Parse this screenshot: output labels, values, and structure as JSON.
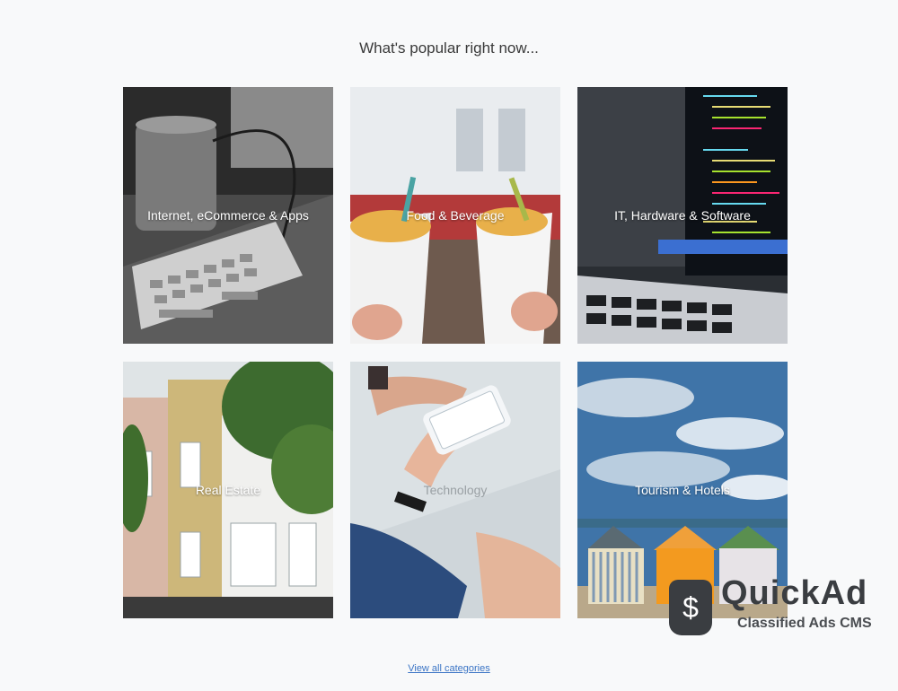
{
  "section": {
    "heading": "What's popular right now..."
  },
  "categories": [
    {
      "label": "Internet, eCommerce & Apps",
      "icon": "keyboard-coffee-photo"
    },
    {
      "label": "Food & Beverage",
      "icon": "fries-photo"
    },
    {
      "label": "IT, Hardware & Software",
      "icon": "laptop-code-photo"
    },
    {
      "label": "Real Estate",
      "icon": "houses-photo"
    },
    {
      "label": "Technology",
      "icon": "phone-hands-photo"
    },
    {
      "label": "Tourism & Hotels",
      "icon": "beach-huts-photo"
    }
  ],
  "view_all": {
    "label": "View all categories"
  },
  "watermark": {
    "brand": "QuickAd",
    "tagline": "Classified Ads CMS",
    "symbol": "$"
  },
  "colors": {
    "link": "#3a74c5",
    "heading": "#3a3a3a",
    "background": "#f8f9fa",
    "watermark": "#3a3d41"
  }
}
